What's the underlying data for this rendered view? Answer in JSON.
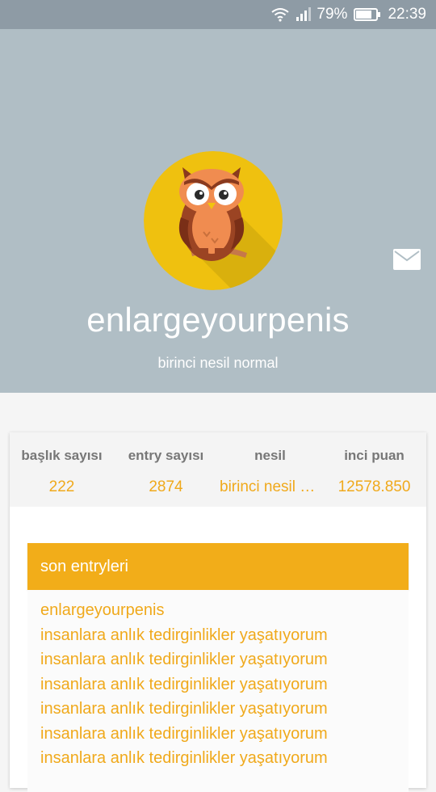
{
  "status_bar": {
    "wifi_icon": "wifi-icon",
    "signal_icon": "cell-signal-icon",
    "battery_percent": "79%",
    "battery_level": 0.79,
    "battery_icon": "battery-icon",
    "time": "22:39"
  },
  "profile": {
    "avatar_icon": "owl-avatar",
    "username": "enlargeyourpenis",
    "subtitle": "birinci nesil normal",
    "message_icon": "mail-icon"
  },
  "stats": [
    {
      "label": "başlık sayısı",
      "value": "222"
    },
    {
      "label": "entry sayısı",
      "value": "2874"
    },
    {
      "label": "nesil",
      "value": "birinci nesil normal"
    },
    {
      "label": "inci puan",
      "value": "12578.850"
    }
  ],
  "recent": {
    "header": "son entryleri",
    "items": [
      "enlargeyourpenis",
      "insanlara anlık tedirginlikler yaşatıyorum",
      "insanlara anlık tedirginlikler yaşatıyorum",
      "insanlara anlık tedirginlikler yaşatıyorum",
      "insanlara anlık tedirginlikler yaşatıyorum",
      "insanlara anlık tedirginlikler yaşatıyorum",
      "insanlara anlık tedirginlikler yaşatıyorum"
    ]
  },
  "colors": {
    "header_bg": "#b0bec5",
    "accent": "#f2ad19",
    "link": "#f0a91b",
    "avatar_bg": "#efc10f"
  }
}
